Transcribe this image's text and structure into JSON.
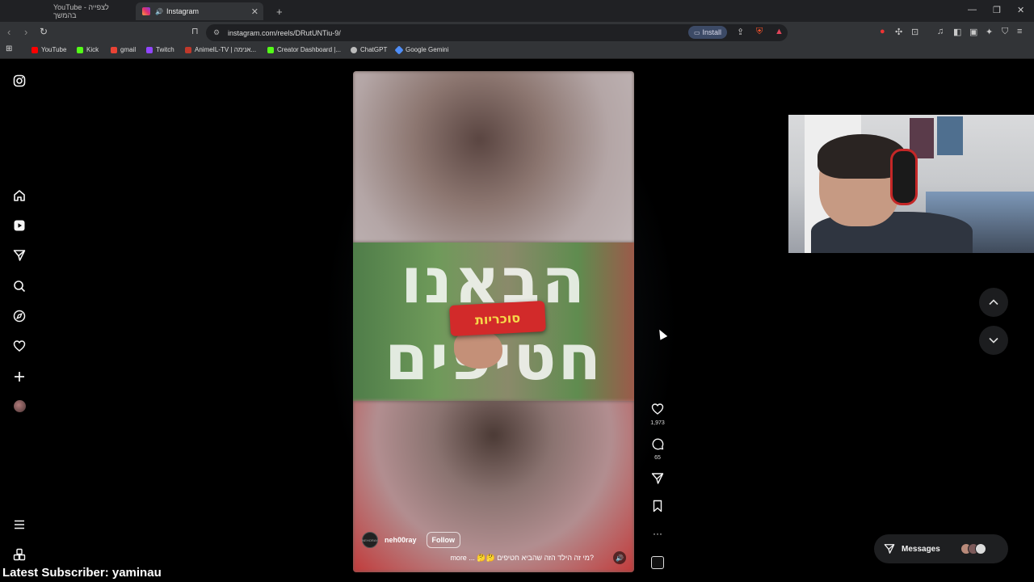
{
  "browser": {
    "tabs": [
      {
        "title": "YouTube - לצפייה בהמשך",
        "active": false,
        "favicon": "youtube-icon"
      },
      {
        "title": "Instagram",
        "active": true,
        "favicon": "instagram-icon"
      }
    ],
    "new_tab": "+",
    "window_controls": {
      "minimize": "—",
      "maximize": "❐",
      "close": "✕"
    },
    "address": "instagram.com/reels/DRutUNTiu-9/",
    "install_label": "Install",
    "bookmarks": [
      {
        "label": "YouTube",
        "color": "#ff0000"
      },
      {
        "label": "Kick",
        "color": "#53fc18"
      },
      {
        "label": "gmail",
        "color": "#ea4335"
      },
      {
        "label": "Twitch",
        "color": "#9146ff"
      },
      {
        "label": "AnimeIL-TV | אנימה...",
        "color": "#c0392b"
      },
      {
        "label": "Creator Dashboard |...",
        "color": "#53fc18"
      },
      {
        "label": "ChatGPT",
        "color": "#bbbbbb"
      },
      {
        "label": "Google Gemini",
        "color": "#4f8ef7"
      }
    ]
  },
  "sidebar": {
    "items": [
      {
        "name": "instagram-icon",
        "glyph": "◎"
      },
      {
        "name": "home-icon",
        "glyph": "⌂"
      },
      {
        "name": "reels-icon",
        "glyph": "▶"
      },
      {
        "name": "direct-send-icon",
        "glyph": "➢"
      },
      {
        "name": "search-icon",
        "glyph": "⌕"
      },
      {
        "name": "explore-compass-icon",
        "glyph": "◈"
      },
      {
        "name": "notifications-heart-icon",
        "glyph": "♡"
      },
      {
        "name": "create-plus-icon",
        "glyph": "+"
      },
      {
        "name": "profile-avatar-icon",
        "glyph": "●"
      },
      {
        "name": "menu-hamburger-icon",
        "glyph": "≡"
      },
      {
        "name": "apps-grid-icon",
        "glyph": "⊞"
      }
    ]
  },
  "reel": {
    "overlay_line1": "הבאנו",
    "overlay_line2": "חטיפים",
    "snack_label": "סוכריות",
    "username": "neh00ray",
    "follow_label": "Follow",
    "caption": "more ... 🤔🤔 מי זה הילד הזה שהביא חטיפים?",
    "avatar_text": "NEHORAY"
  },
  "actions": {
    "likes": "1,973",
    "comments": "65"
  },
  "messages_label": "Messages",
  "overlay": {
    "subscriber_text": "Latest Subscriber: yaminau"
  }
}
